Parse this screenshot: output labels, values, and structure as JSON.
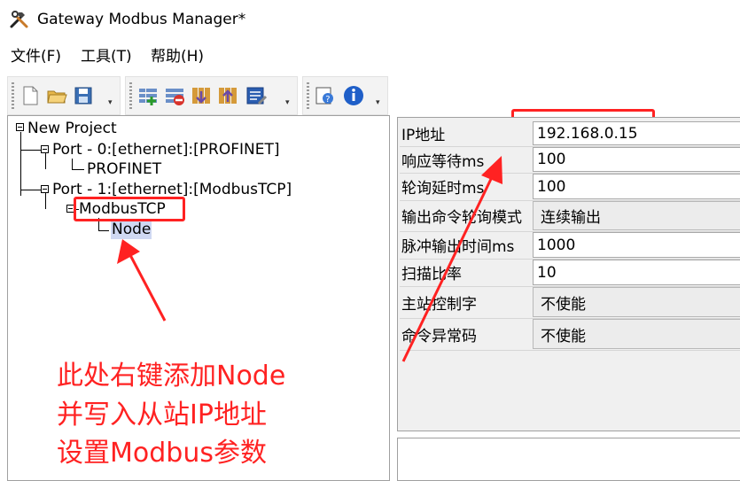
{
  "window": {
    "title": "Gateway Modbus Manager*"
  },
  "menu": [
    {
      "label": "文件(F)"
    },
    {
      "label": "工具(T)"
    },
    {
      "label": "帮助(H)"
    }
  ],
  "toolbar": {
    "group1": [
      "new-file-icon",
      "open-folder-icon",
      "save-icon"
    ],
    "group2": [
      "add-item-icon",
      "remove-item-icon",
      "download-icon",
      "upload-icon",
      "edit-icon"
    ],
    "group3": [
      "help-search-icon",
      "info-icon"
    ],
    "overflow_glyph": "▾"
  },
  "tree": {
    "root": "New Project",
    "port0": "Port - 0:[ethernet]:[PROFINET]",
    "port0_child": "PROFINET",
    "port1": "Port - 1:[ethernet]:[ModbusTCP]",
    "port1_child": "ModbusTCP",
    "node": "Node"
  },
  "annotation": {
    "line1": "此处右键添加Node",
    "line2": "并写入从站IP地址",
    "line3": "设置Modbus参数"
  },
  "properties": [
    {
      "label": "IP地址",
      "value": "192.168.0.15"
    },
    {
      "label": "响应等待ms",
      "value": "100"
    },
    {
      "label": "轮询延时ms",
      "value": "100"
    },
    {
      "label": "输出命令轮询模式",
      "value": "连续输出"
    },
    {
      "label": "脉冲输出时间ms",
      "value": "1000"
    },
    {
      "label": "扫描比率",
      "value": "10"
    },
    {
      "label": "主站控制字",
      "value": "不使能"
    },
    {
      "label": "命令异常码",
      "value": "不使能"
    }
  ],
  "colors": {
    "annotation": "#ff2222",
    "selection": "#cfd8f2",
    "toolbar_bg": "#f3f3f3"
  }
}
